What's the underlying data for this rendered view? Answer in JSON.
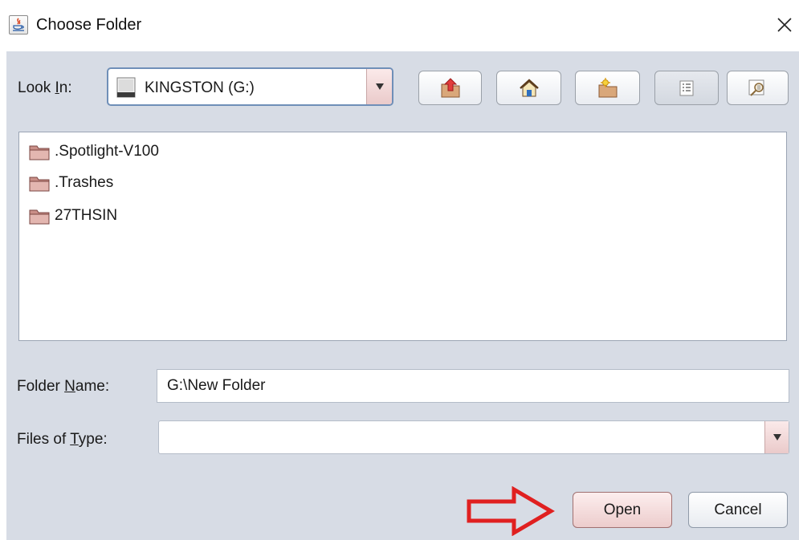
{
  "window": {
    "title": "Choose Folder",
    "app_icon": "java-icon",
    "close_icon": "close-icon"
  },
  "look_in": {
    "label_prefix": "Look ",
    "label_mnemonic": "I",
    "label_suffix": "n:",
    "value": "KINGSTON (G:)",
    "icon": "drive-icon"
  },
  "toolbar": [
    {
      "name": "up-one-level",
      "icon": "folder-up-icon"
    },
    {
      "name": "home",
      "icon": "home-icon"
    },
    {
      "name": "create-new-folder",
      "icon": "new-folder-icon"
    },
    {
      "name": "list-view",
      "icon": "list-view-icon",
      "active": true
    },
    {
      "name": "details-view",
      "icon": "details-view-icon"
    }
  ],
  "files": [
    {
      "name": ".Spotlight-V100",
      "icon": "folder-icon"
    },
    {
      "name": ".Trashes",
      "icon": "folder-icon"
    },
    {
      "name": "27THSIN",
      "icon": "folder-icon"
    }
  ],
  "folder_name": {
    "label_prefix": "Folder ",
    "label_mnemonic": "N",
    "label_suffix": "ame:",
    "value": "G:\\New Folder"
  },
  "files_of_type": {
    "label_prefix": "Files of ",
    "label_mnemonic": "T",
    "label_suffix": "ype:",
    "value": ""
  },
  "buttons": {
    "open": "Open",
    "cancel": "Cancel"
  },
  "annotation": {
    "icon": "red-arrow-icon",
    "color": "#e02020"
  },
  "colors": {
    "dialog_background": "#d7dce5",
    "combo_border": "#6f8fb8",
    "default_button": "#eccccc"
  }
}
